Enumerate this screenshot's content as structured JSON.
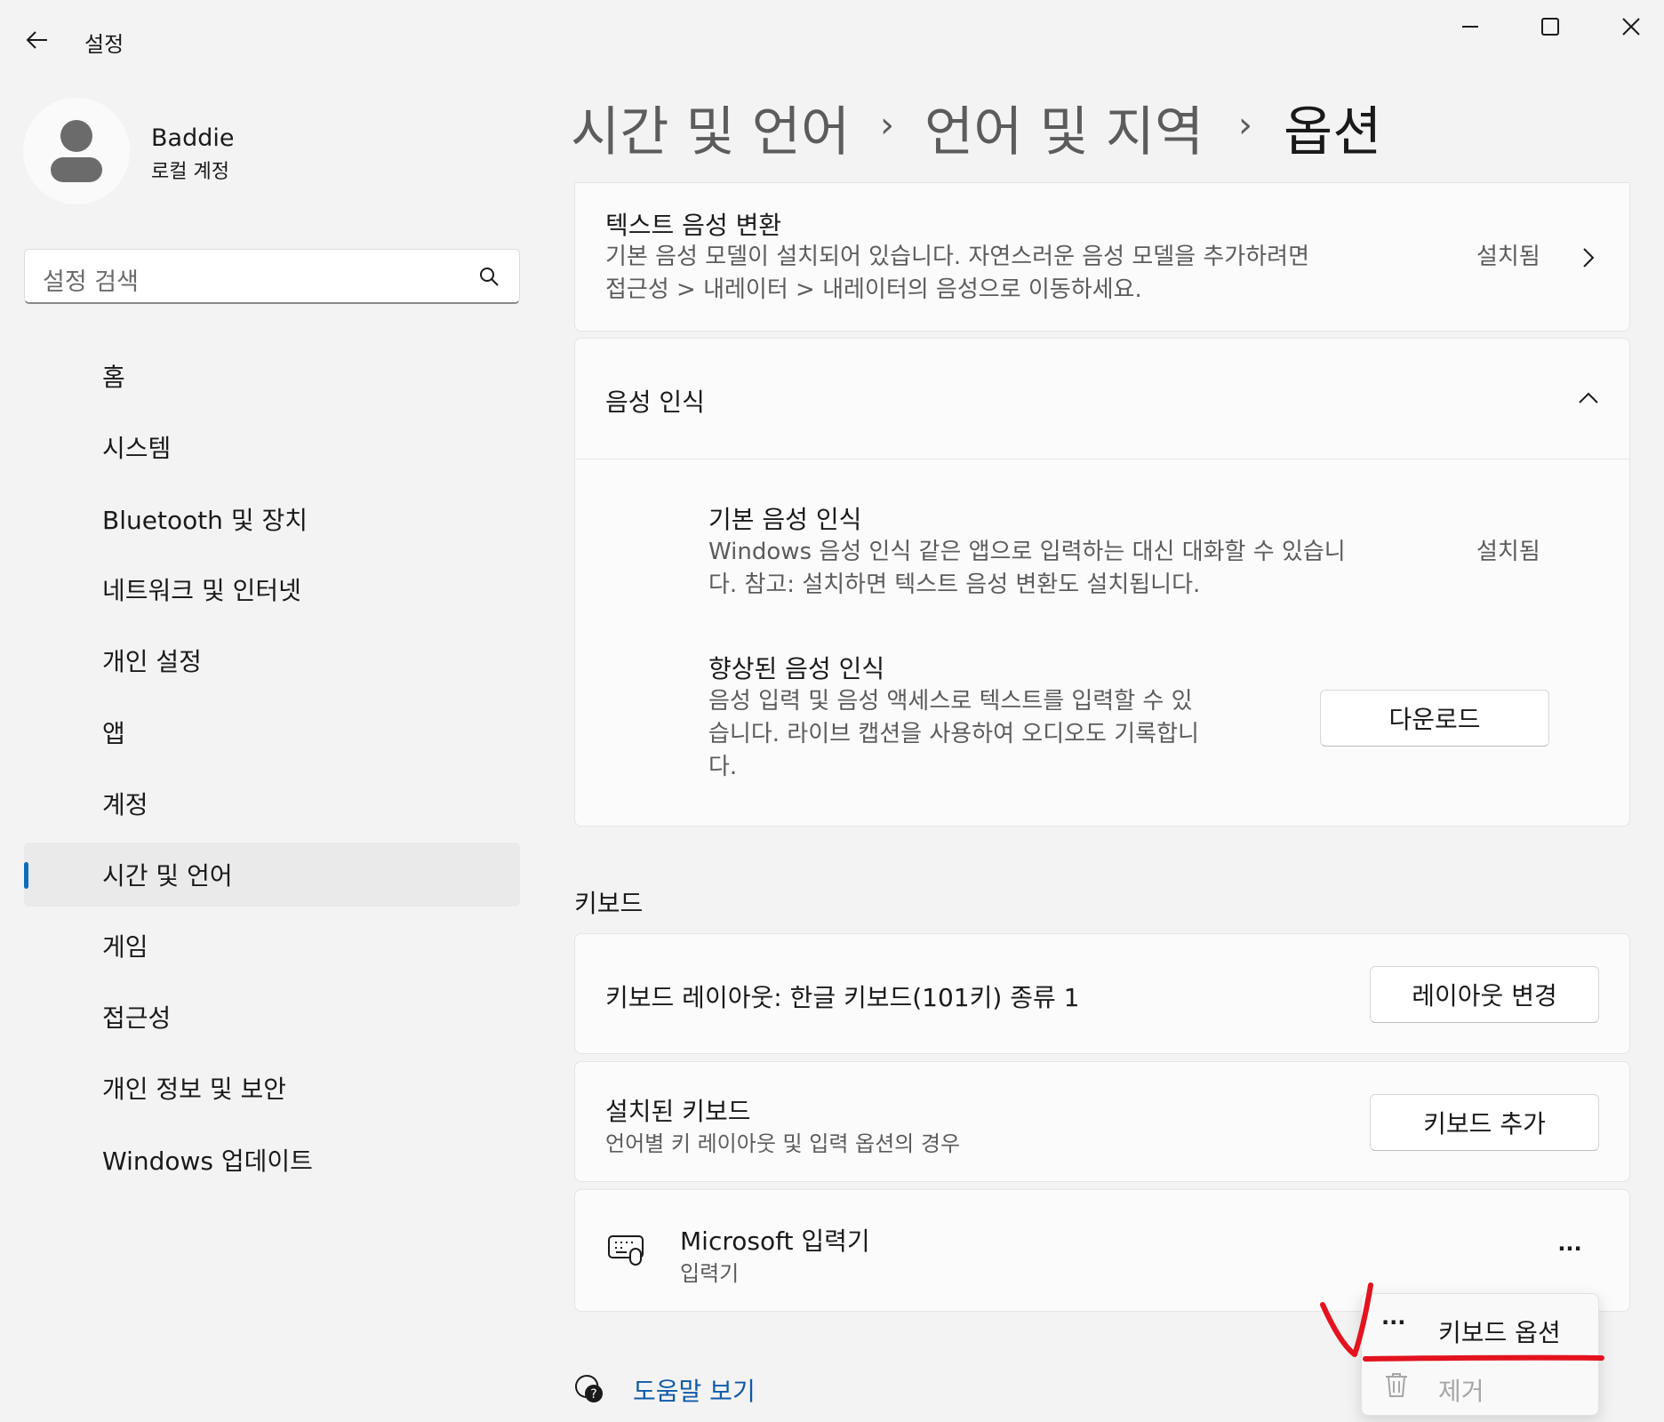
{
  "window": {
    "title": "설정"
  },
  "profile": {
    "name": "Baddie",
    "account_type": "로컬 계정"
  },
  "search": {
    "placeholder": "설정 검색"
  },
  "nav": [
    {
      "label": "홈"
    },
    {
      "label": "시스템"
    },
    {
      "label": "Bluetooth 및 장치"
    },
    {
      "label": "네트워크 및 인터넷"
    },
    {
      "label": "개인 설정"
    },
    {
      "label": "앱"
    },
    {
      "label": "계정"
    },
    {
      "label": "시간 및 언어",
      "selected": true
    },
    {
      "label": "게임"
    },
    {
      "label": "접근성"
    },
    {
      "label": "개인 정보 및 보안"
    },
    {
      "label": "Windows 업데이트"
    }
  ],
  "breadcrumb": {
    "level1": "시간 및 언어",
    "level2": "언어 및 지역",
    "level3": "옵션",
    "separator": "›"
  },
  "tts": {
    "title": "텍스트 음성 변환",
    "desc_line1": "기본 음성 모델이 설치되어 있습니다. 자연스러운 음성 모델을 추가하려면",
    "desc_line2": "접근성 > 내레이터 > 내레이터의 음성으로 이동하세요.",
    "status": "설치됨"
  },
  "speech": {
    "title": "음성 인식",
    "basic": {
      "title": "기본 음성 인식",
      "desc_line1": "Windows 음성 인식 같은 앱으로 입력하는 대신 대화할 수 있습니",
      "desc_line2": "다. 참고: 설치하면 텍스트 음성 변환도 설치됩니다.",
      "status": "설치됨"
    },
    "enhanced": {
      "title": "향상된 음성 인식",
      "desc_line1": "음성 입력 및 음성 액세스로 텍스트를 입력할 수 있",
      "desc_line2": "습니다. 라이브 캡션을 사용하여 오디오도 기록합니",
      "desc_line3": "다.",
      "button": "다운로드"
    }
  },
  "keyboard": {
    "section_label": "키보드",
    "layout_text": "키보드 레이아웃: 한글 키보드(101키) 종류 1",
    "layout_button": "레이아웃 변경",
    "installed_title": "설치된 키보드",
    "installed_desc": "언어별 키 레이아웃 및 입력 옵션의 경우",
    "add_button": "키보드 추가",
    "ime": {
      "name": "Microsoft 입력기",
      "sub": "입력기",
      "more": "···"
    }
  },
  "context_menu": {
    "items": [
      {
        "icon": "more-icon",
        "label": "키보드 옵션"
      },
      {
        "icon": "trash-icon",
        "label": "제거",
        "disabled": true
      }
    ]
  },
  "help": {
    "label": "도움말 보기"
  },
  "colors": {
    "accent": "#0f6cbd",
    "annotation": "#e3131f"
  }
}
